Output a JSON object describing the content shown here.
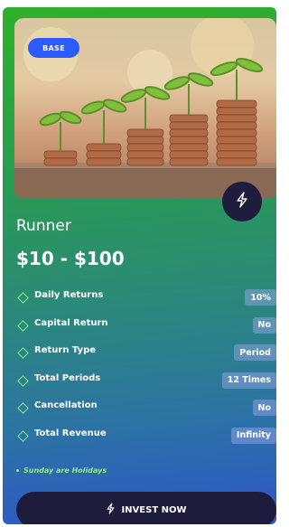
{
  "plan": {
    "badge": "BASE",
    "name": "Runner",
    "price": "$10 - $100",
    "details": [
      {
        "label": "Daily Returns",
        "value": "10%"
      },
      {
        "label": "Capital Return",
        "value": "No"
      },
      {
        "label": "Return Type",
        "value": "Period"
      },
      {
        "label": "Total Periods",
        "value": "12 Times"
      },
      {
        "label": "Cancellation",
        "value": "No"
      },
      {
        "label": "Total Revenue",
        "value": "Infinity"
      }
    ],
    "note": "Sunday are Holidays",
    "invest_label": "INVEST NOW"
  },
  "icons": {
    "photo": "coins-with-plants-image",
    "action": "lightning-bolt-icon",
    "row_marker": "diamond-icon"
  },
  "colors": {
    "badge": "#2c5bff",
    "button": "#1e1c3c",
    "accent": "#7ff07a"
  }
}
